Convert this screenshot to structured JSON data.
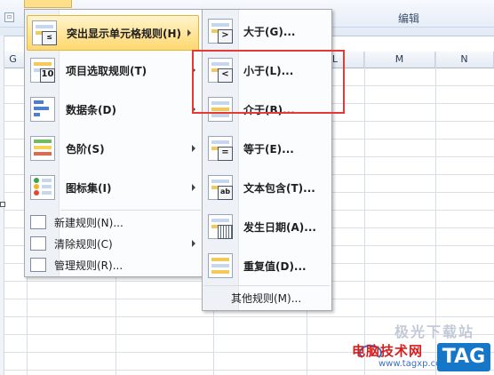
{
  "ribbon": {
    "group_caption": "编辑",
    "launcher": "⊡"
  },
  "columns": {
    "left": [
      "G"
    ],
    "right": [
      "L",
      "M",
      "N"
    ]
  },
  "main_menu": {
    "items": [
      {
        "label": "突出显示单元格规则(H)",
        "has_submenu": true,
        "highlighted": true
      },
      {
        "label": "项目选取规则(T)",
        "has_submenu": true
      },
      {
        "label": "数据条(D)",
        "has_submenu": true
      },
      {
        "label": "色阶(S)",
        "has_submenu": true
      },
      {
        "label": "图标集(I)",
        "has_submenu": true
      },
      {
        "label": "新建规则(N)..."
      },
      {
        "label": "清除规则(C)",
        "has_submenu": true
      },
      {
        "label": "管理规则(R)..."
      }
    ],
    "badges": {
      "top_10": "10"
    }
  },
  "sub_menu": {
    "items": [
      {
        "label": "大于(G)...",
        "badge": ">"
      },
      {
        "label": "小于(L)...",
        "badge": "<"
      },
      {
        "label": "介于(B)...",
        "badge": ""
      },
      {
        "label": "等于(E)...",
        "badge": "="
      },
      {
        "label": "文本包含(T)...",
        "badge": "ab"
      },
      {
        "label": "发生日期(A)...",
        "badge": ""
      },
      {
        "label": "重复值(D)...",
        "badge": ""
      },
      {
        "label": "其他规则(M)..."
      }
    ]
  },
  "watermark": {
    "faint": "极光下载站",
    "cn": "电脑技术网",
    "url": "www.tagxp.com",
    "tag": "TAG"
  },
  "colors": {
    "highlight": "#ffd86e",
    "annotation": "#e53935",
    "watermark_red": "#d81e1e",
    "watermark_blue": "#1677c8"
  }
}
